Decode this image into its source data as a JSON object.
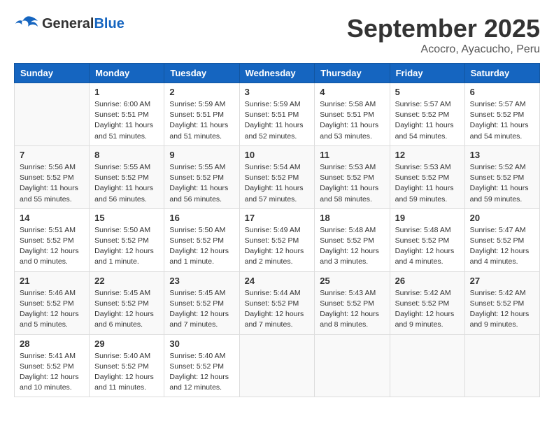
{
  "logo": {
    "general": "General",
    "blue": "Blue"
  },
  "header": {
    "month": "September 2025",
    "location": "Acocro, Ayacucho, Peru"
  },
  "weekdays": [
    "Sunday",
    "Monday",
    "Tuesday",
    "Wednesday",
    "Thursday",
    "Friday",
    "Saturday"
  ],
  "weeks": [
    [
      {
        "day": "",
        "info": ""
      },
      {
        "day": "1",
        "info": "Sunrise: 6:00 AM\nSunset: 5:51 PM\nDaylight: 11 hours\nand 51 minutes."
      },
      {
        "day": "2",
        "info": "Sunrise: 5:59 AM\nSunset: 5:51 PM\nDaylight: 11 hours\nand 51 minutes."
      },
      {
        "day": "3",
        "info": "Sunrise: 5:59 AM\nSunset: 5:51 PM\nDaylight: 11 hours\nand 52 minutes."
      },
      {
        "day": "4",
        "info": "Sunrise: 5:58 AM\nSunset: 5:51 PM\nDaylight: 11 hours\nand 53 minutes."
      },
      {
        "day": "5",
        "info": "Sunrise: 5:57 AM\nSunset: 5:52 PM\nDaylight: 11 hours\nand 54 minutes."
      },
      {
        "day": "6",
        "info": "Sunrise: 5:57 AM\nSunset: 5:52 PM\nDaylight: 11 hours\nand 54 minutes."
      }
    ],
    [
      {
        "day": "7",
        "info": "Sunrise: 5:56 AM\nSunset: 5:52 PM\nDaylight: 11 hours\nand 55 minutes."
      },
      {
        "day": "8",
        "info": "Sunrise: 5:55 AM\nSunset: 5:52 PM\nDaylight: 11 hours\nand 56 minutes."
      },
      {
        "day": "9",
        "info": "Sunrise: 5:55 AM\nSunset: 5:52 PM\nDaylight: 11 hours\nand 56 minutes."
      },
      {
        "day": "10",
        "info": "Sunrise: 5:54 AM\nSunset: 5:52 PM\nDaylight: 11 hours\nand 57 minutes."
      },
      {
        "day": "11",
        "info": "Sunrise: 5:53 AM\nSunset: 5:52 PM\nDaylight: 11 hours\nand 58 minutes."
      },
      {
        "day": "12",
        "info": "Sunrise: 5:53 AM\nSunset: 5:52 PM\nDaylight: 11 hours\nand 59 minutes."
      },
      {
        "day": "13",
        "info": "Sunrise: 5:52 AM\nSunset: 5:52 PM\nDaylight: 11 hours\nand 59 minutes."
      }
    ],
    [
      {
        "day": "14",
        "info": "Sunrise: 5:51 AM\nSunset: 5:52 PM\nDaylight: 12 hours\nand 0 minutes."
      },
      {
        "day": "15",
        "info": "Sunrise: 5:50 AM\nSunset: 5:52 PM\nDaylight: 12 hours\nand 1 minute."
      },
      {
        "day": "16",
        "info": "Sunrise: 5:50 AM\nSunset: 5:52 PM\nDaylight: 12 hours\nand 1 minute."
      },
      {
        "day": "17",
        "info": "Sunrise: 5:49 AM\nSunset: 5:52 PM\nDaylight: 12 hours\nand 2 minutes."
      },
      {
        "day": "18",
        "info": "Sunrise: 5:48 AM\nSunset: 5:52 PM\nDaylight: 12 hours\nand 3 minutes."
      },
      {
        "day": "19",
        "info": "Sunrise: 5:48 AM\nSunset: 5:52 PM\nDaylight: 12 hours\nand 4 minutes."
      },
      {
        "day": "20",
        "info": "Sunrise: 5:47 AM\nSunset: 5:52 PM\nDaylight: 12 hours\nand 4 minutes."
      }
    ],
    [
      {
        "day": "21",
        "info": "Sunrise: 5:46 AM\nSunset: 5:52 PM\nDaylight: 12 hours\nand 5 minutes."
      },
      {
        "day": "22",
        "info": "Sunrise: 5:45 AM\nSunset: 5:52 PM\nDaylight: 12 hours\nand 6 minutes."
      },
      {
        "day": "23",
        "info": "Sunrise: 5:45 AM\nSunset: 5:52 PM\nDaylight: 12 hours\nand 7 minutes."
      },
      {
        "day": "24",
        "info": "Sunrise: 5:44 AM\nSunset: 5:52 PM\nDaylight: 12 hours\nand 7 minutes."
      },
      {
        "day": "25",
        "info": "Sunrise: 5:43 AM\nSunset: 5:52 PM\nDaylight: 12 hours\nand 8 minutes."
      },
      {
        "day": "26",
        "info": "Sunrise: 5:42 AM\nSunset: 5:52 PM\nDaylight: 12 hours\nand 9 minutes."
      },
      {
        "day": "27",
        "info": "Sunrise: 5:42 AM\nSunset: 5:52 PM\nDaylight: 12 hours\nand 9 minutes."
      }
    ],
    [
      {
        "day": "28",
        "info": "Sunrise: 5:41 AM\nSunset: 5:52 PM\nDaylight: 12 hours\nand 10 minutes."
      },
      {
        "day": "29",
        "info": "Sunrise: 5:40 AM\nSunset: 5:52 PM\nDaylight: 12 hours\nand 11 minutes."
      },
      {
        "day": "30",
        "info": "Sunrise: 5:40 AM\nSunset: 5:52 PM\nDaylight: 12 hours\nand 12 minutes."
      },
      {
        "day": "",
        "info": ""
      },
      {
        "day": "",
        "info": ""
      },
      {
        "day": "",
        "info": ""
      },
      {
        "day": "",
        "info": ""
      }
    ]
  ]
}
